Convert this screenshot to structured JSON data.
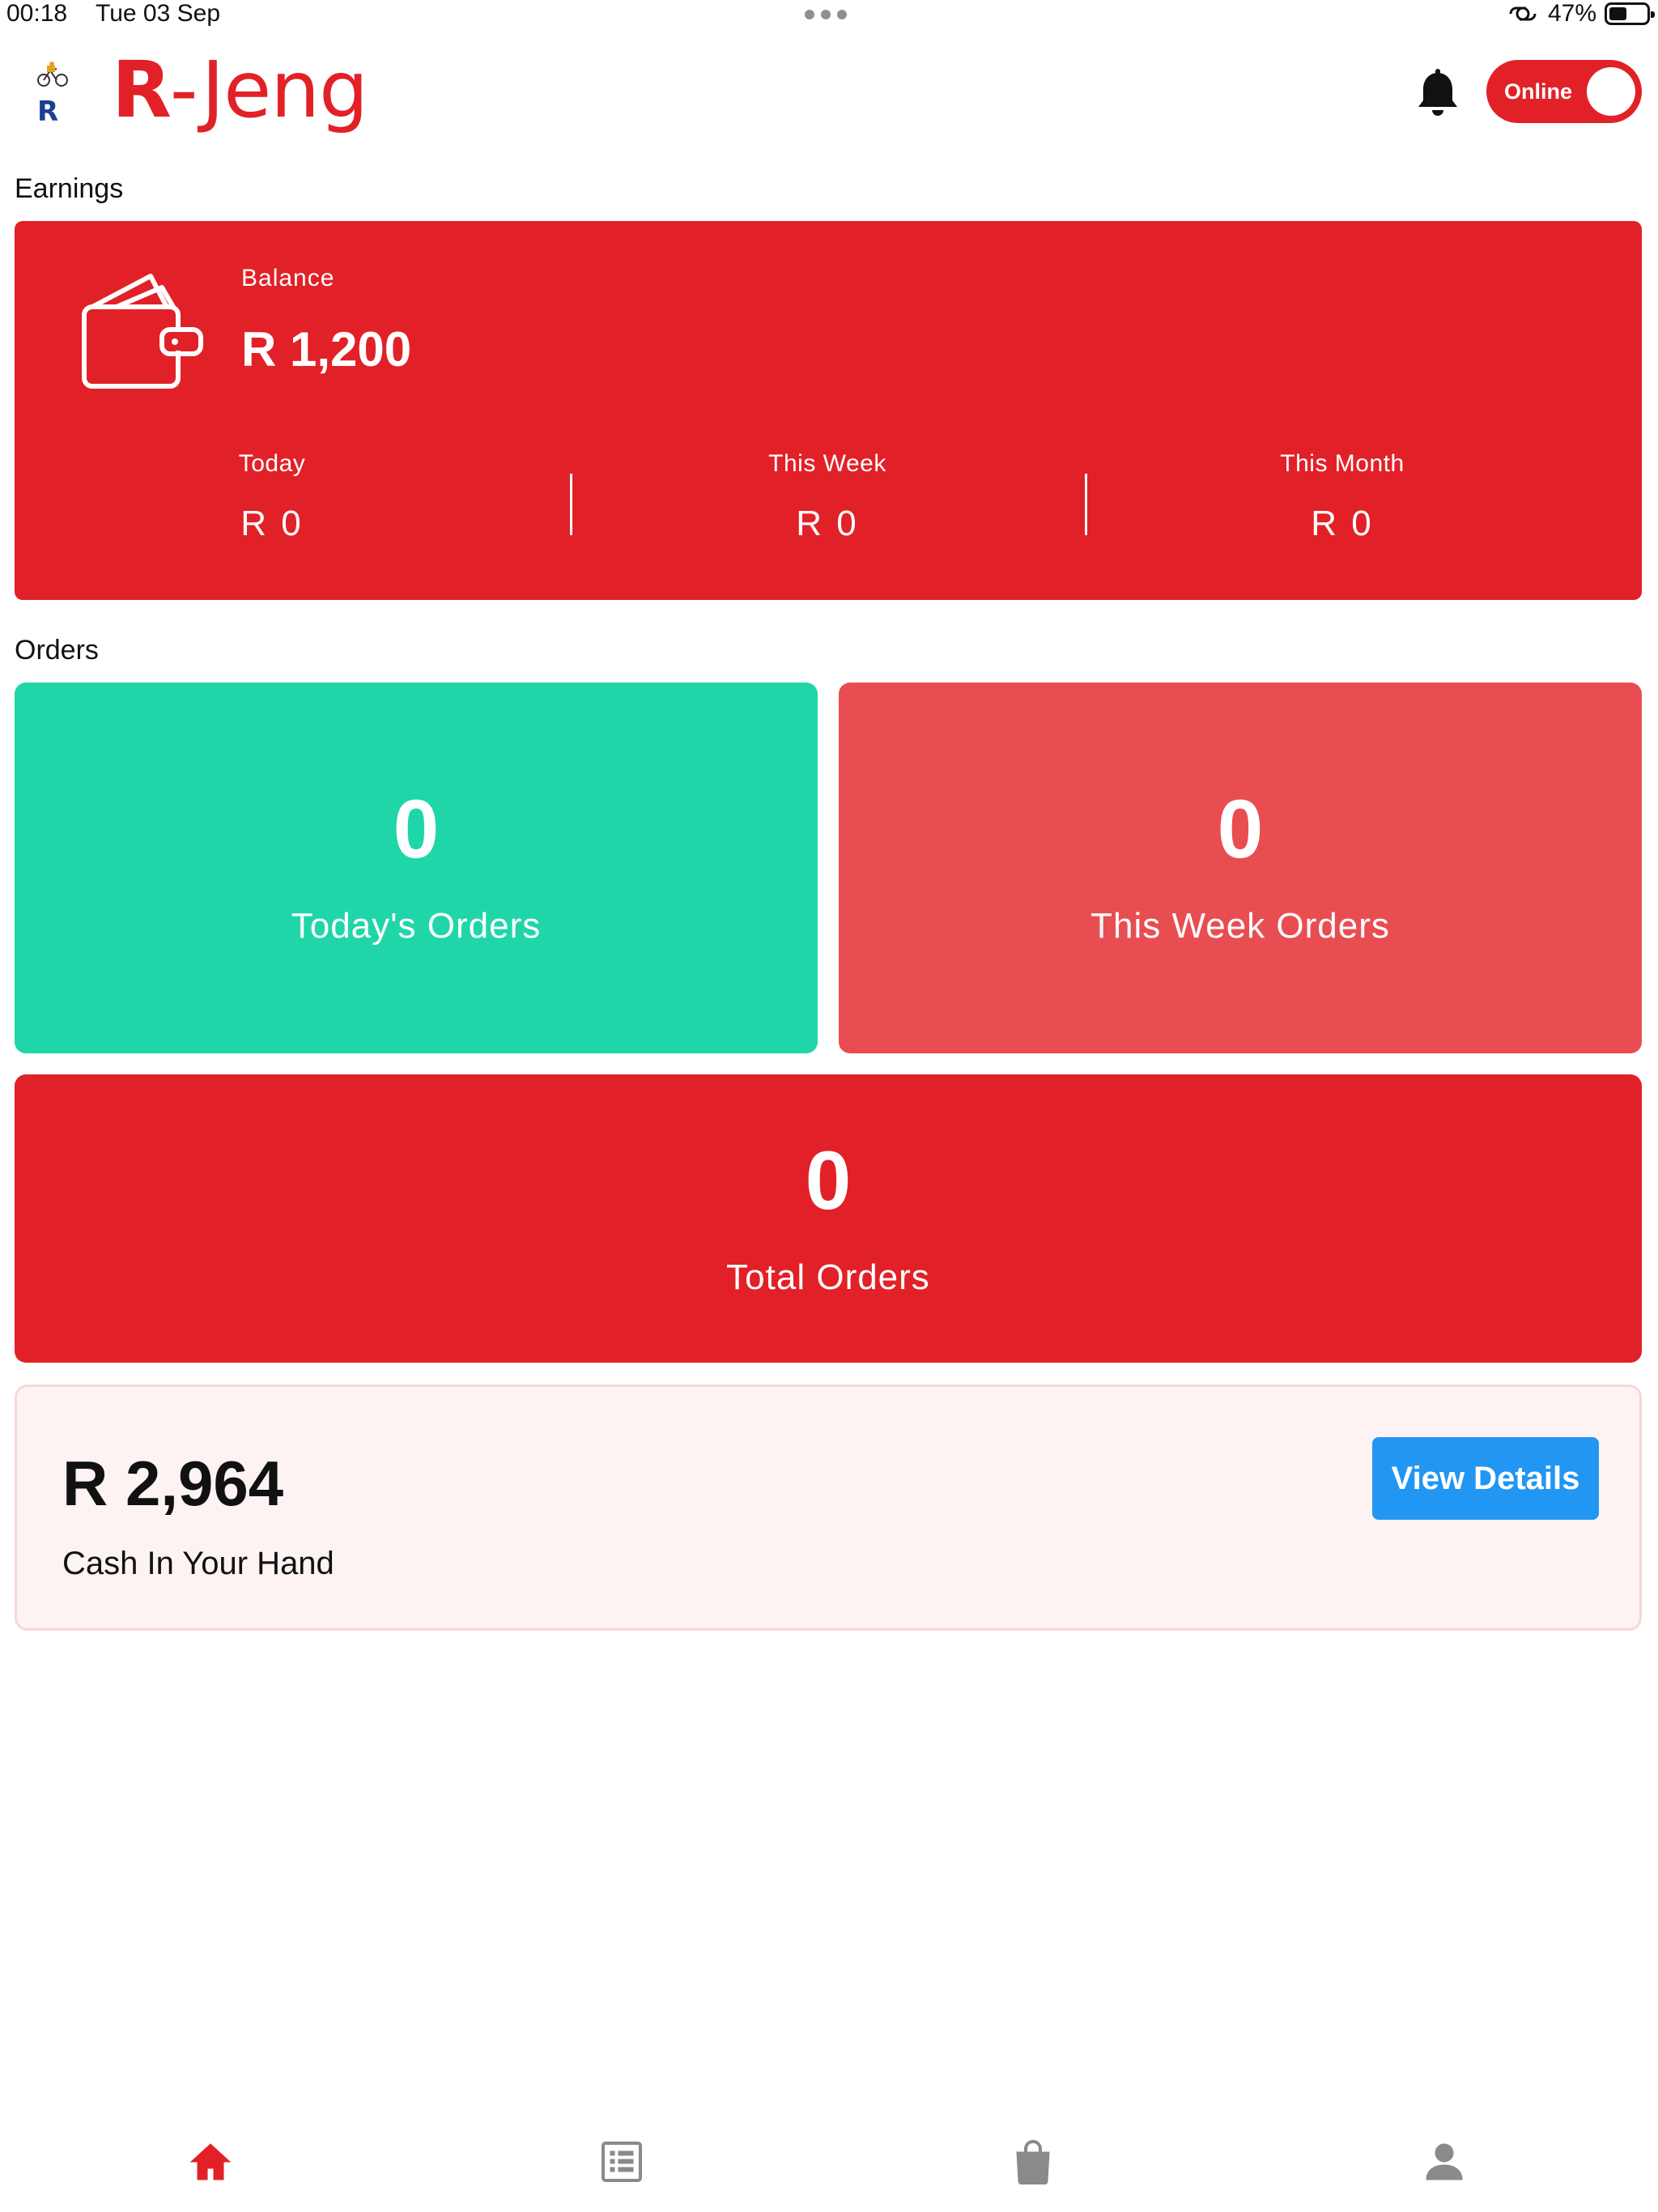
{
  "status_bar": {
    "time": "00:18",
    "date": "Tue 03 Sep",
    "battery_percent": "47%",
    "battery_level": 0.47
  },
  "header": {
    "brand_prefix": "R",
    "brand_rest": "-Jeng",
    "brand_color": "#e12127",
    "notification_icon": "bell-icon",
    "status_toggle": {
      "label": "Online",
      "on": true
    }
  },
  "earnings": {
    "section_title": "Earnings",
    "balance_label": "Balance",
    "balance_value": "R 1,200",
    "wallet_icon": "wallet-icon",
    "periods": [
      {
        "label": "Today",
        "value": "R 0"
      },
      {
        "label": "This Week",
        "value": "R 0"
      },
      {
        "label": "This Month",
        "value": "R 0"
      }
    ]
  },
  "orders": {
    "section_title": "Orders",
    "cards": [
      {
        "count": "0",
        "label": "Today's Orders",
        "color": "#20d6a9"
      },
      {
        "count": "0",
        "label": "This Week Orders",
        "color": "#e84e51"
      },
      {
        "count": "0",
        "label": "Total Orders",
        "color": "#e12127"
      }
    ]
  },
  "cash": {
    "value": "R 2,964",
    "label": "Cash In Your Hand",
    "button_label": "View Details",
    "button_color": "#2196f3"
  },
  "bottom_nav": {
    "items": [
      {
        "icon": "home-icon",
        "active": true
      },
      {
        "icon": "list-icon",
        "active": false
      },
      {
        "icon": "shopping-bag-icon",
        "active": false
      },
      {
        "icon": "profile-icon",
        "active": false
      }
    ],
    "active_color": "#e12127",
    "inactive_color": "#8a8a8a"
  }
}
